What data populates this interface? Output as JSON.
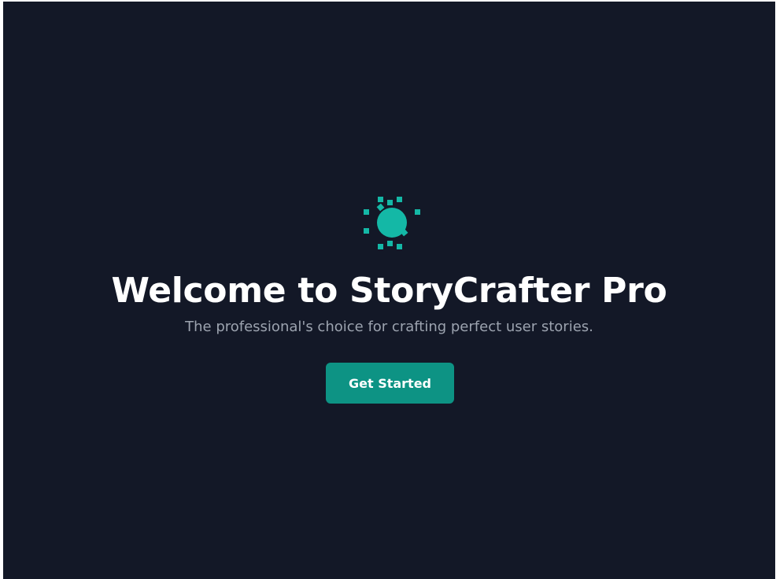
{
  "app": {
    "brand_color": "#14b8a6",
    "background_color": "#131827",
    "logo_icon": "sparkle-circle-icon"
  },
  "hero": {
    "title": "Welcome to StoryCrafter Pro",
    "subtitle": "The professional's choice for crafting perfect user stories.",
    "cta_label": "Get Started"
  }
}
